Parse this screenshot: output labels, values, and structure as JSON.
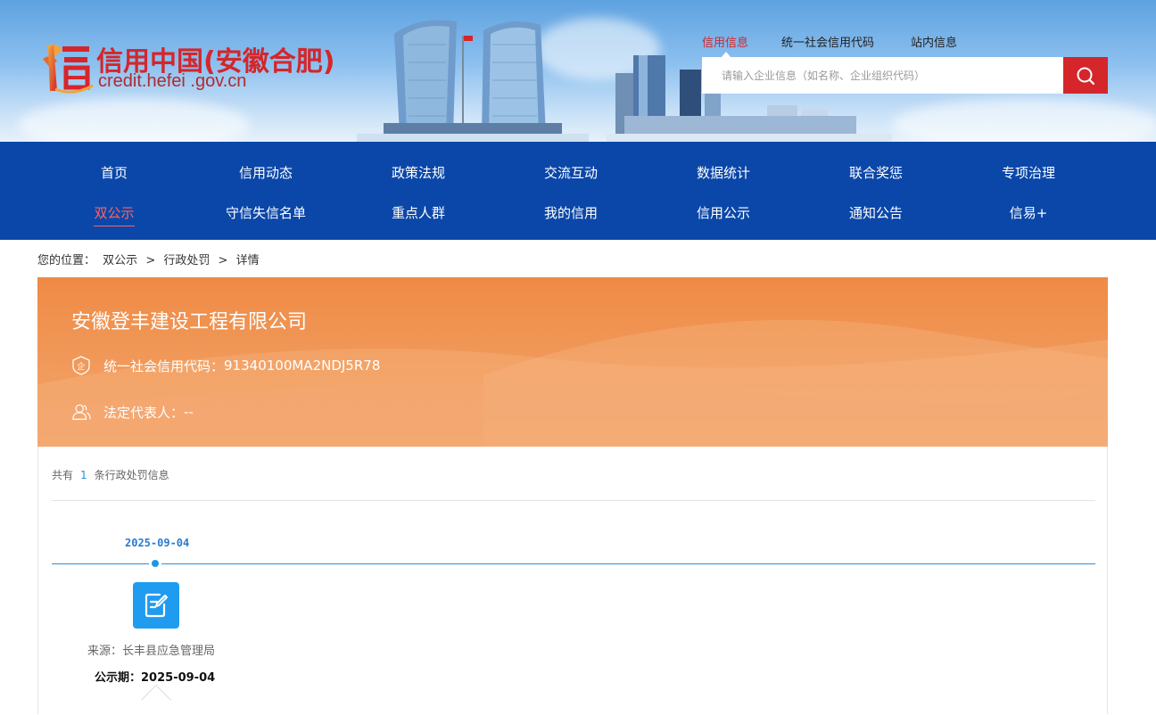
{
  "site": {
    "title": "信用中国(安徽合肥)",
    "domain": "credit.hefei .gov.cn"
  },
  "top_links": [
    {
      "label": "信用信息",
      "active": true
    },
    {
      "label": "统一社会信用代码",
      "active": false
    },
    {
      "label": "站内信息",
      "active": false
    }
  ],
  "search": {
    "placeholder": "请输入企业信息（如名称、企业组织代码）",
    "icon": "search-icon"
  },
  "nav": {
    "row1": [
      "首页",
      "信用动态",
      "政策法规",
      "交流互动",
      "数据统计",
      "联合奖惩",
      "专项治理"
    ],
    "row2": [
      "双公示",
      "守信失信名单",
      "重点人群",
      "我的信用",
      "信用公示",
      "通知公告",
      "信易+"
    ],
    "active": "双公示"
  },
  "breadcrumb": {
    "prefix": "您的位置：",
    "items": [
      "双公示",
      "行政处罚",
      "详情"
    ],
    "separator": ">"
  },
  "company": {
    "name": "安徽登丰建设工程有限公司",
    "credit_code_label": "统一社会信用代码：",
    "credit_code": "91340100MA2NDJ5R78",
    "legal_rep_label": "法定代表人：",
    "legal_rep": "--"
  },
  "records": {
    "count_prefix": "共有",
    "count": "1",
    "count_suffix": "条行政处罚信息"
  },
  "timeline": {
    "date": "2025-09-04",
    "source_label": "来源：",
    "source": "长丰县应急管理局",
    "period_label": "公示期：",
    "period": "2025-09-04",
    "icon": "edit-document-icon"
  },
  "colors": {
    "brand_red": "#d4262b",
    "nav_blue": "#0b47a8",
    "banner_orange": "#ef8a45",
    "timeline_blue": "#1f95e8"
  }
}
